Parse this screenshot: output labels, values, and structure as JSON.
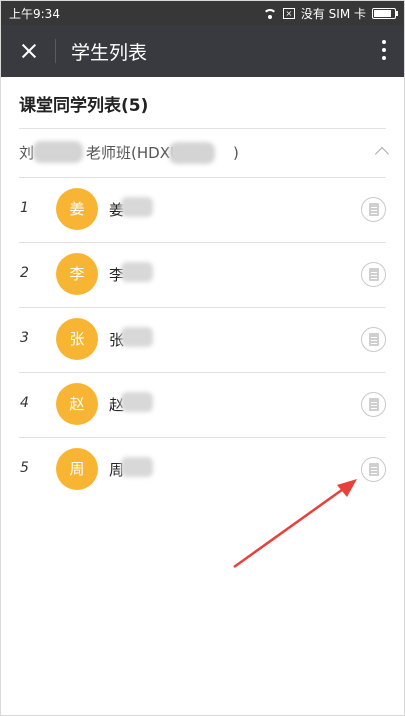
{
  "status_bar": {
    "time": "上午9:34",
    "carrier": "没有 SIM 卡"
  },
  "header": {
    "title": "学生列表"
  },
  "section": {
    "title": "课堂同学列表(5)"
  },
  "class_group": {
    "name_prefix": "刘",
    "name_middle": "老师班(HDXU",
    "name_suffix": ")"
  },
  "students": [
    {
      "index": "1",
      "avatar": "姜",
      "name": "姜"
    },
    {
      "index": "2",
      "avatar": "李",
      "name": "李"
    },
    {
      "index": "3",
      "avatar": "张",
      "name": "张"
    },
    {
      "index": "4",
      "avatar": "赵",
      "name": "赵"
    },
    {
      "index": "5",
      "avatar": "周",
      "name": "周"
    }
  ],
  "colors": {
    "title_bar": "#393a3f",
    "avatar": "#f8b534",
    "annotation_arrow": "#e8403a"
  }
}
